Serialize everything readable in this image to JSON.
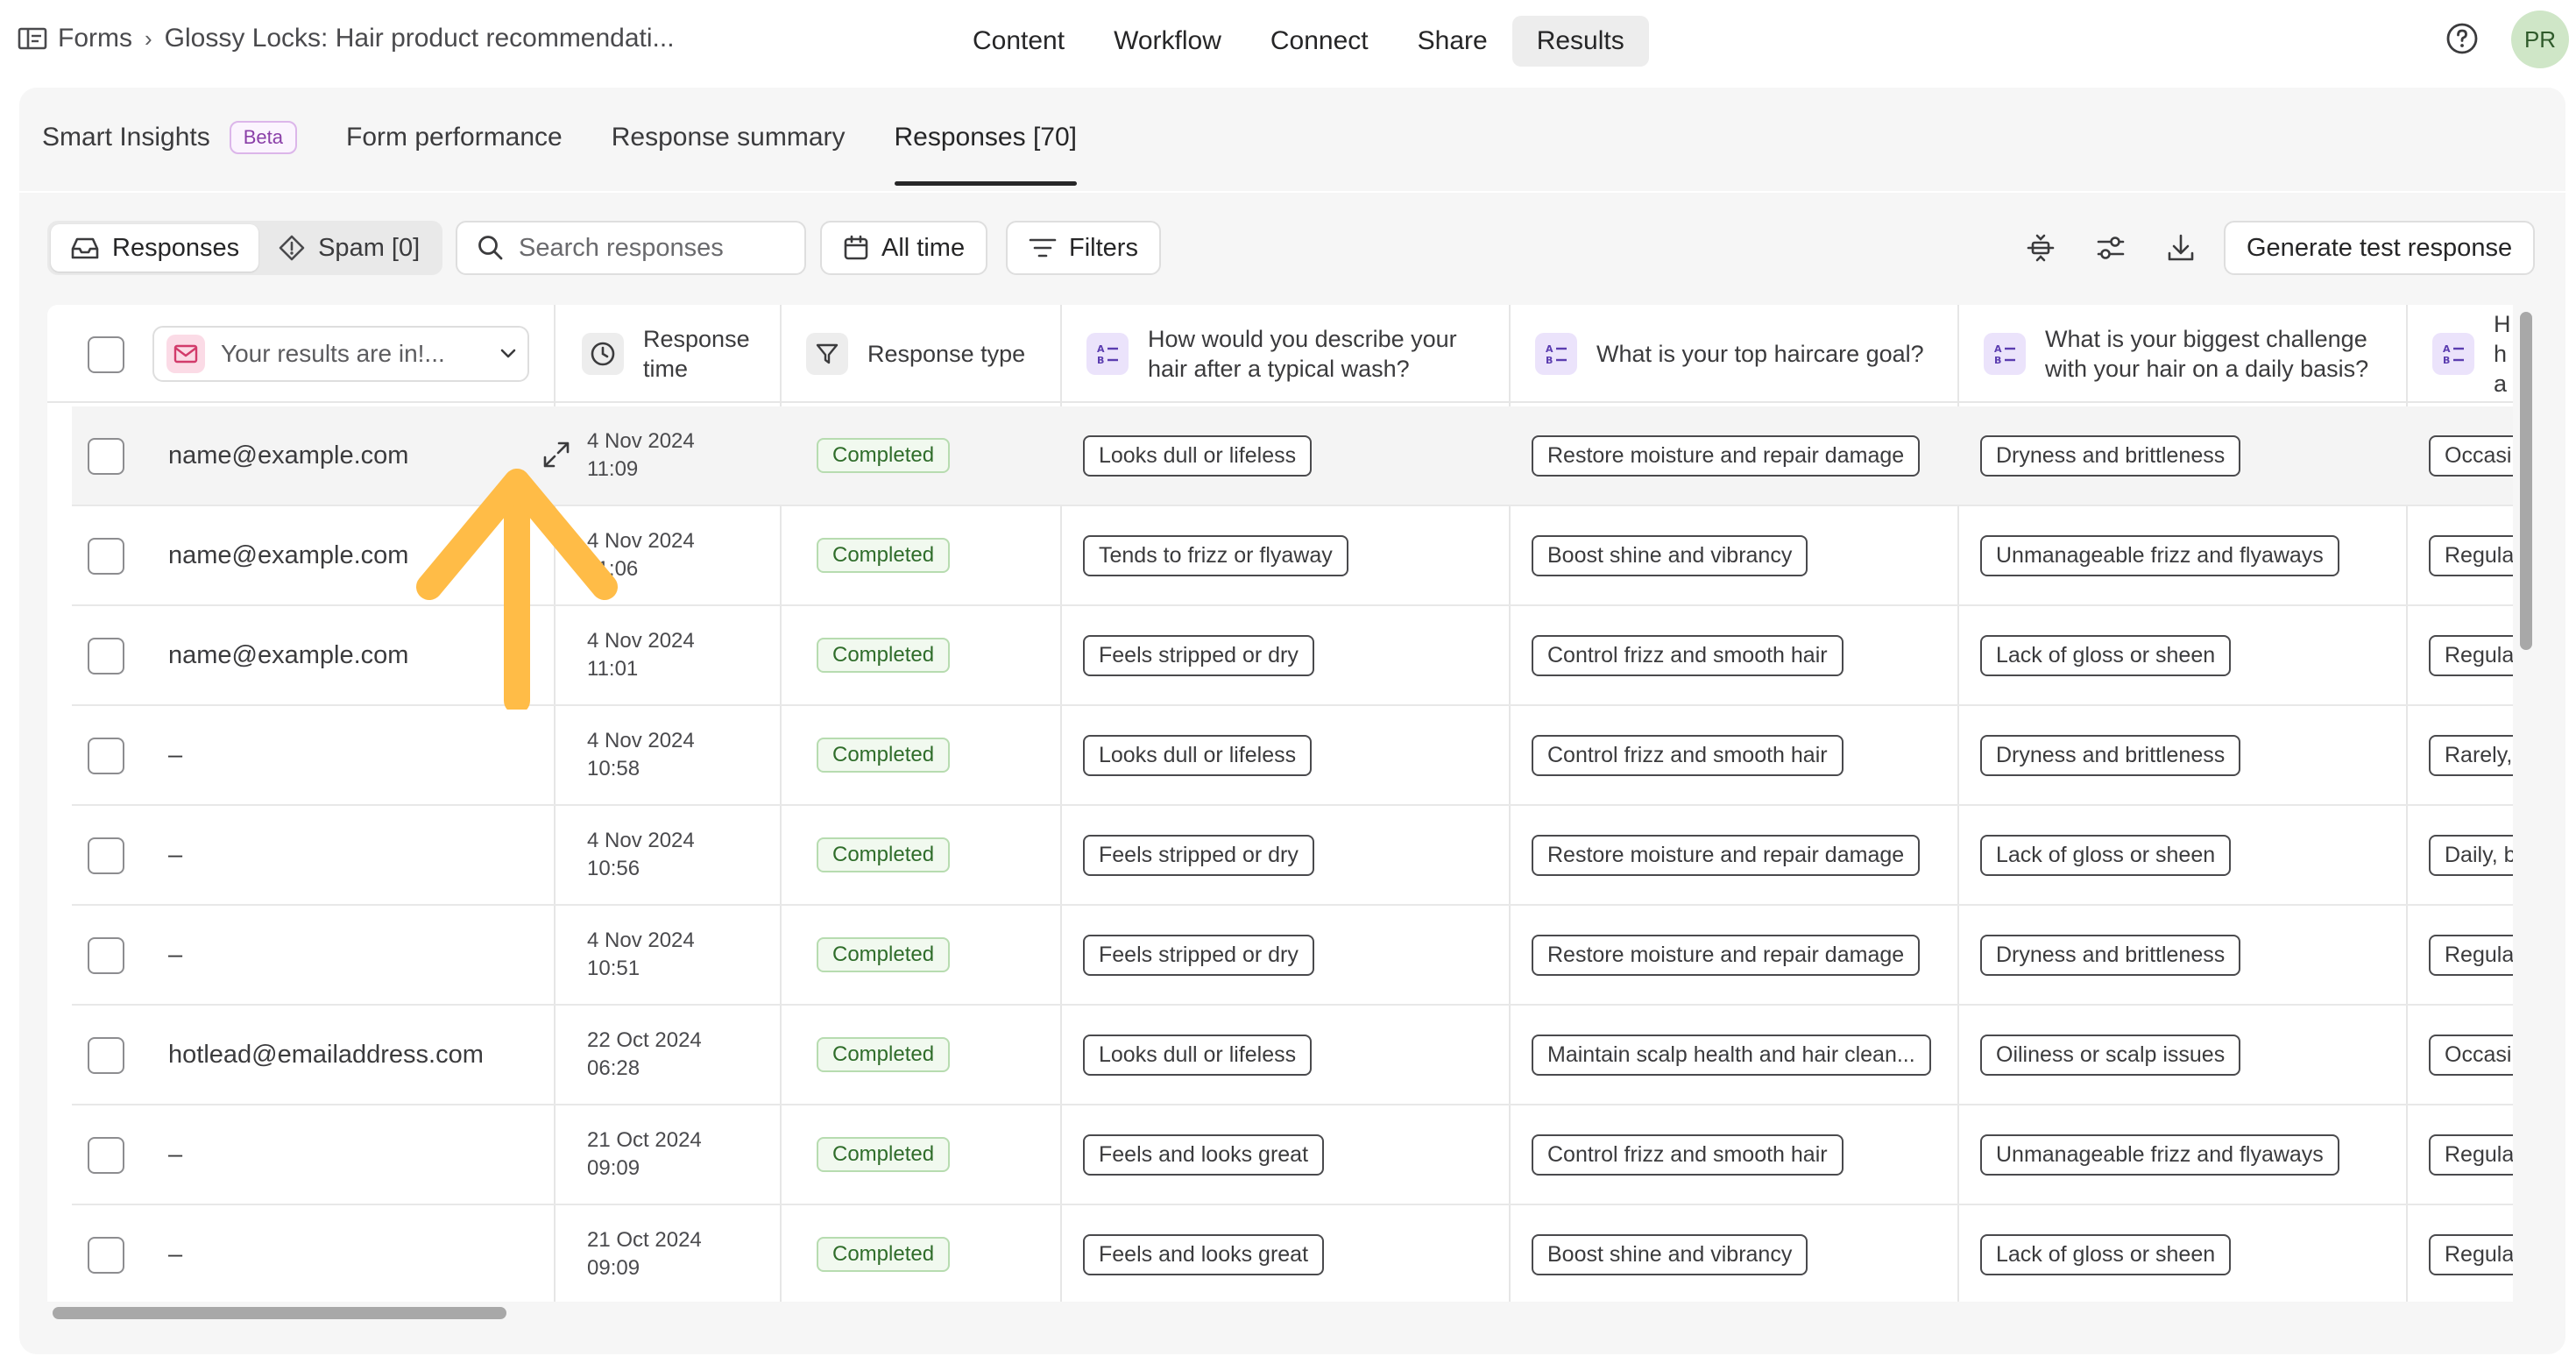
{
  "breadcrumb": {
    "root": "Forms",
    "current": "Glossy Locks: Hair product recommendati..."
  },
  "nav": [
    "Content",
    "Workflow",
    "Connect",
    "Share",
    "Results"
  ],
  "nav_active": "Results",
  "user_initials": "PR",
  "subtabs": {
    "smart_insights": "Smart Insights",
    "beta": "Beta",
    "form_performance": "Form performance",
    "response_summary": "Response summary",
    "responses": "Responses [70]"
  },
  "toolbar": {
    "responses": "Responses",
    "spam": "Spam [0]",
    "search_placeholder": "Search responses",
    "all_time": "All time",
    "filters": "Filters",
    "generate": "Generate test response"
  },
  "columns": {
    "email_filter": "Your results are in!...",
    "response_time": "Response time",
    "response_type": "Response type",
    "q1": "How would you describe your hair after a typical wash?",
    "q2": "What is your top haircare goal?",
    "q3": "What is your biggest challenge with your hair on a daily basis?",
    "q4": "H ha"
  },
  "rows": [
    {
      "email": "name@example.com",
      "date": "4 Nov 2024",
      "time": "11:09",
      "status": "Completed",
      "q1": "Looks dull or lifeless",
      "q2": "Restore moisture and repair damage",
      "q3": "Dryness and brittleness",
      "q4": "Occasi"
    },
    {
      "email": "name@example.com",
      "date": "4 Nov 2024",
      "time": "11:06",
      "status": "Completed",
      "q1": "Tends to frizz or flyaway",
      "q2": "Boost shine and vibrancy",
      "q3": "Unmanageable frizz and flyaways",
      "q4": "Regula"
    },
    {
      "email": "name@example.com",
      "date": "4 Nov 2024",
      "time": "11:01",
      "status": "Completed",
      "q1": "Feels stripped or dry",
      "q2": "Control frizz and smooth hair",
      "q3": "Lack of gloss or sheen",
      "q4": "Regula"
    },
    {
      "email": "–",
      "date": "4 Nov 2024",
      "time": "10:58",
      "status": "Completed",
      "q1": "Looks dull or lifeless",
      "q2": "Control frizz and smooth hair",
      "q3": "Dryness and brittleness",
      "q4": "Rarely,"
    },
    {
      "email": "–",
      "date": "4 Nov 2024",
      "time": "10:56",
      "status": "Completed",
      "q1": "Feels stripped or dry",
      "q2": "Restore moisture and repair damage",
      "q3": "Lack of gloss or sheen",
      "q4": "Daily, b"
    },
    {
      "email": "–",
      "date": "4 Nov 2024",
      "time": "10:51",
      "status": "Completed",
      "q1": "Feels stripped or dry",
      "q2": "Restore moisture and repair damage",
      "q3": "Dryness and brittleness",
      "q4": "Regula"
    },
    {
      "email": "hotlead@emailaddress.com",
      "date": "22 Oct 2024",
      "time": "06:28",
      "status": "Completed",
      "q1": "Looks dull or lifeless",
      "q2": "Maintain scalp health and hair clean...",
      "q3": "Oiliness or scalp issues",
      "q4": "Occasi"
    },
    {
      "email": "–",
      "date": "21 Oct 2024",
      "time": "09:09",
      "status": "Completed",
      "q1": "Feels and looks great",
      "q2": "Control frizz and smooth hair",
      "q3": "Unmanageable frizz and flyaways",
      "q4": "Regula"
    },
    {
      "email": "–",
      "date": "21 Oct 2024",
      "time": "09:09",
      "status": "Completed",
      "q1": "Feels and looks great",
      "q2": "Boost shine and vibrancy",
      "q3": "Lack of gloss or sheen",
      "q4": "Regula"
    }
  ],
  "colors": {
    "arrow": "#ffbc47",
    "status_text": "#2f6d2a",
    "beta": "#8a3fa8",
    "avatar_bg": "#cfe6c7"
  },
  "icons": [
    "forms-icon",
    "help-icon",
    "inbox-icon",
    "spam-icon",
    "search-icon",
    "calendar-icon",
    "filter-icon",
    "density-icon",
    "columns-settings-icon",
    "download-icon",
    "mail-icon",
    "chevron-down-icon",
    "clock-icon",
    "funnel-icon",
    "choice-question-icon",
    "expand-icon",
    "annotation-arrow"
  ]
}
